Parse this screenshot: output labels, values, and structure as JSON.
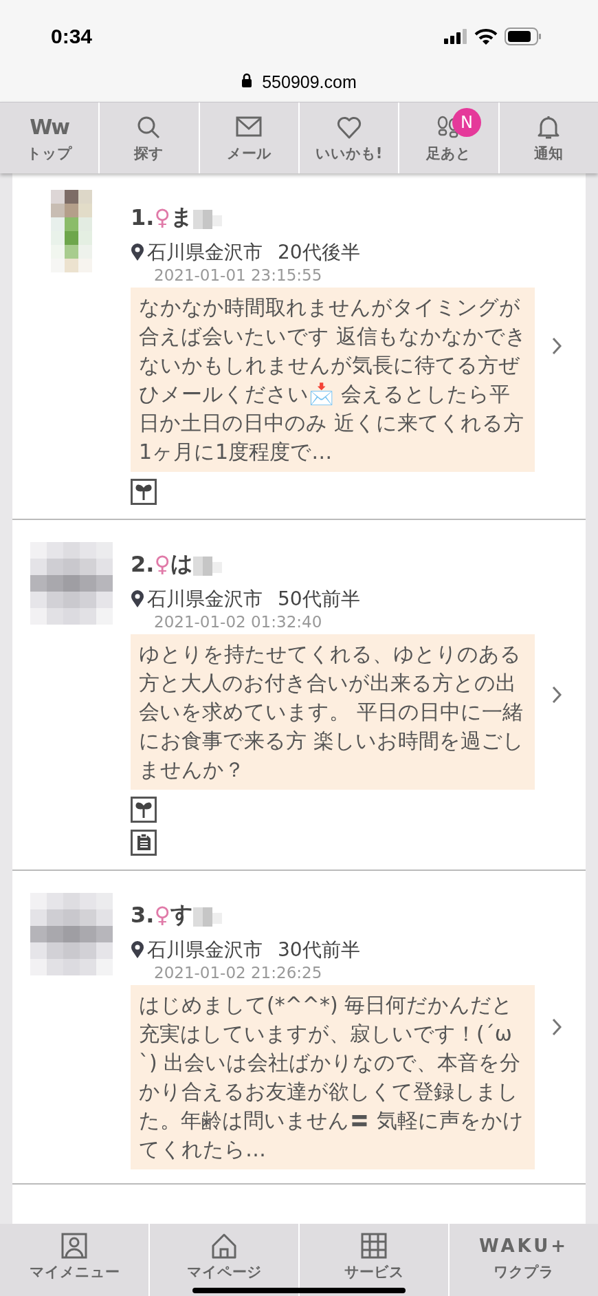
{
  "status_bar": {
    "time": "0:34"
  },
  "address_bar": {
    "url": "550909.com"
  },
  "nav_tabs": [
    {
      "kind": "logo",
      "logo": "Ww",
      "label": "トップ"
    },
    {
      "kind": "search",
      "label": "探す"
    },
    {
      "kind": "mail",
      "label": "メール"
    },
    {
      "kind": "heart",
      "label": "いいかも!"
    },
    {
      "kind": "footprints",
      "label": "足あと",
      "badge": "N"
    },
    {
      "kind": "bell",
      "label": "通知"
    }
  ],
  "profiles": [
    {
      "number": "1.",
      "gender": "♀",
      "name": "ま",
      "location": "石川県金沢市",
      "age": "20代後半",
      "date": "2021-01-01 23:15:55",
      "message": "なかなか時間取れませんがタイミングが合えば会いたいです 返信もなかなかできないかもしれませんが気長に待てる方ぜひメールください📩 会えるとしたら平日か土日の日中のみ 近くに来てくれる方 1ヶ月に1度程度で…",
      "sprout_badge": true,
      "document_badge": false
    },
    {
      "number": "2.",
      "gender": "♀",
      "name": "は",
      "location": "石川県金沢市",
      "age": "50代前半",
      "date": "2021-01-02 01:32:40",
      "message": "ゆとりを持たせてくれる、ゆとりのある方と大人のお付き合いが出来る方との出会いを求めています。 平日の日中に一緒にお食事で来る方 楽しいお時間を過ごしませんか？",
      "sprout_badge": true,
      "document_badge": true
    },
    {
      "number": "3.",
      "gender": "♀",
      "name": "す",
      "location": "石川県金沢市",
      "age": "30代前半",
      "date": "2021-01-02 21:26:25",
      "message": "はじめまして(*^^*) 毎日何だかんだと充実はしていますが、寂しいです！(´ω`) 出会いは会社ばかりなので、本音を分かり合えるお友達が欲しくて登録しました。年齢は問いません〓 気軽に声をかけてくれたら…",
      "sprout_badge": false,
      "document_badge": false
    }
  ],
  "bottom_tabs": [
    {
      "kind": "person",
      "label": "マイメニュー"
    },
    {
      "kind": "home",
      "label": "マイページ"
    },
    {
      "kind": "grid",
      "label": "サービス"
    },
    {
      "kind": "logo",
      "logo": "WAKU+",
      "label": "ワクプラ"
    }
  ]
}
